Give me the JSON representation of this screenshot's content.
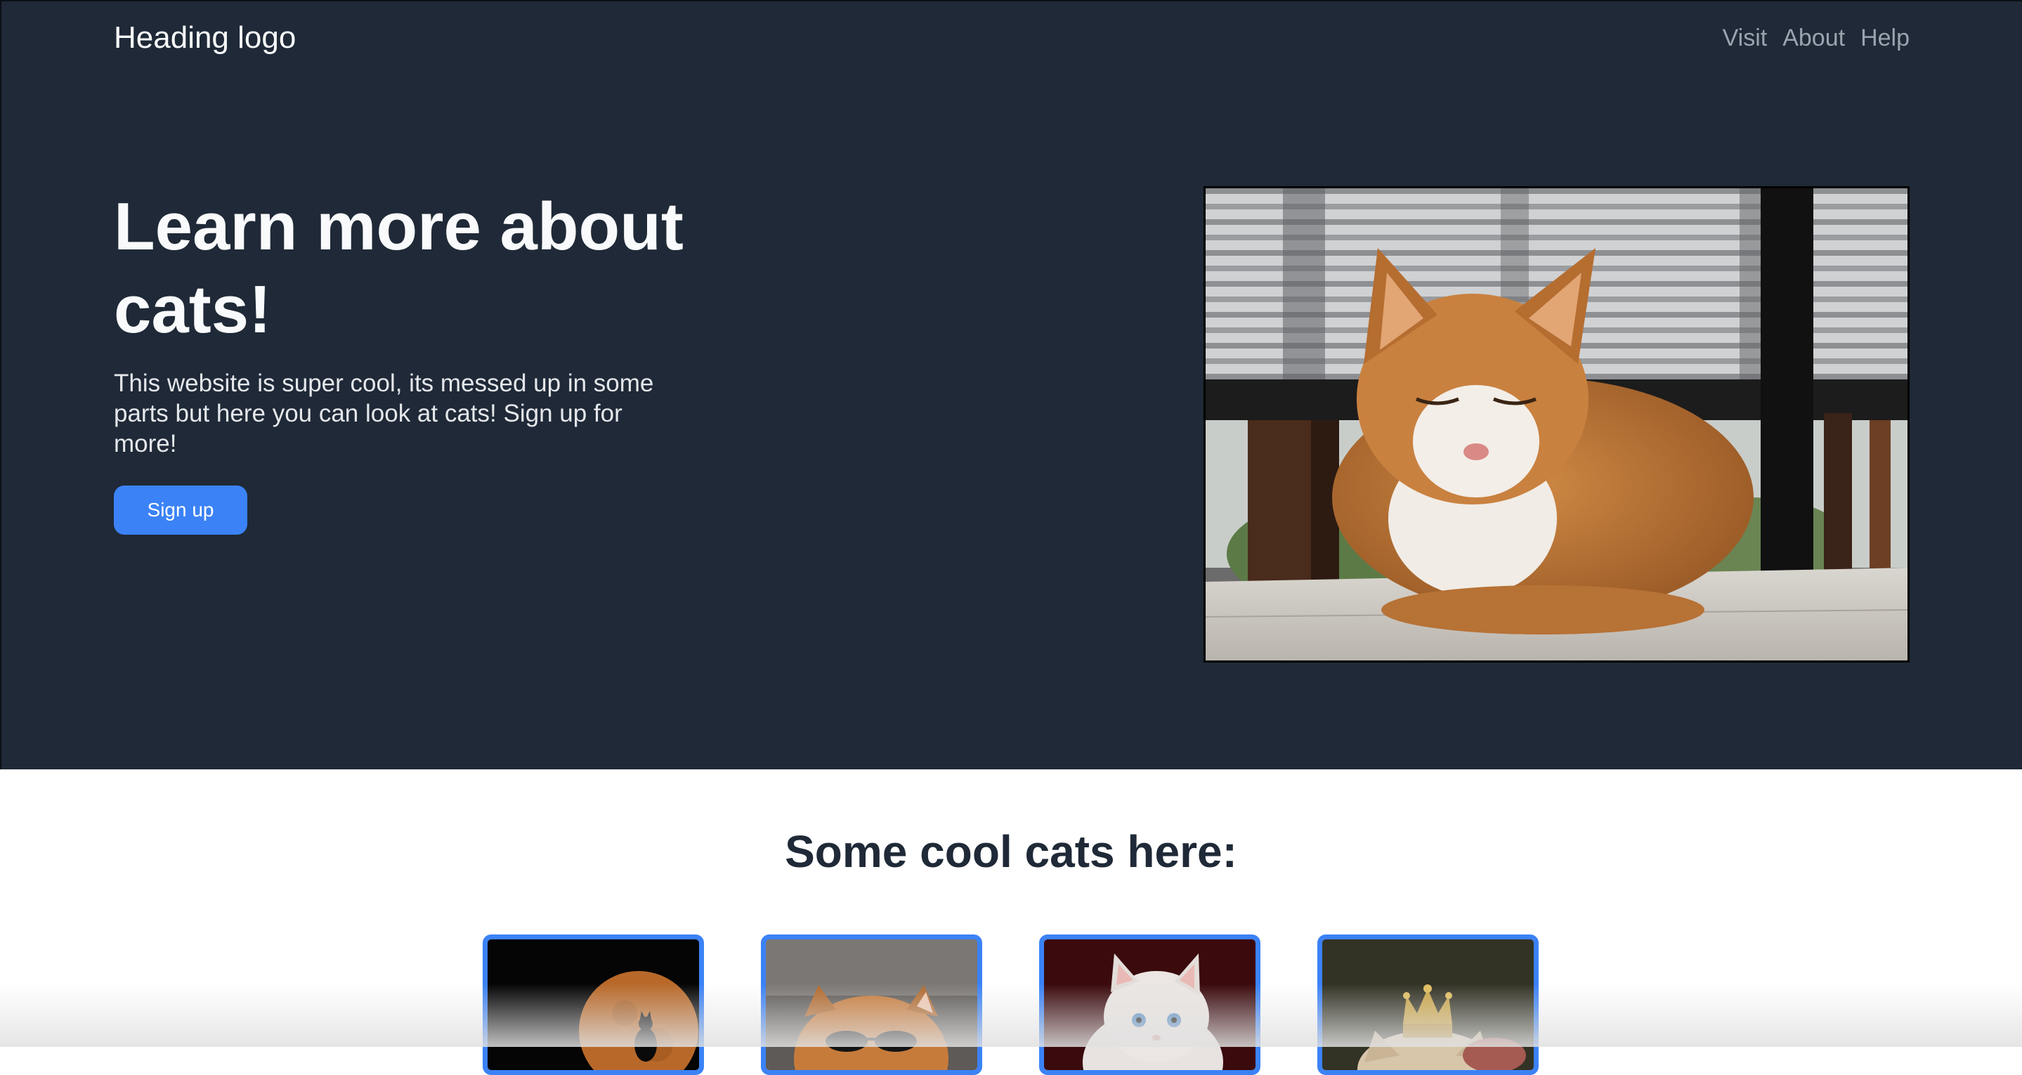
{
  "header": {
    "logo": "Heading logo",
    "nav": [
      "Visit",
      "About",
      "Help"
    ]
  },
  "hero": {
    "title": "Learn more about cats!",
    "text": "This website is super cool, its messed up in some parts but here you can look at cats! Sign up for more!",
    "button": "Sign up"
  },
  "gallery": {
    "title": "Some cool cats here:"
  },
  "colors": {
    "hero_bg": "#1f2937",
    "accent": "#3b82f6"
  }
}
